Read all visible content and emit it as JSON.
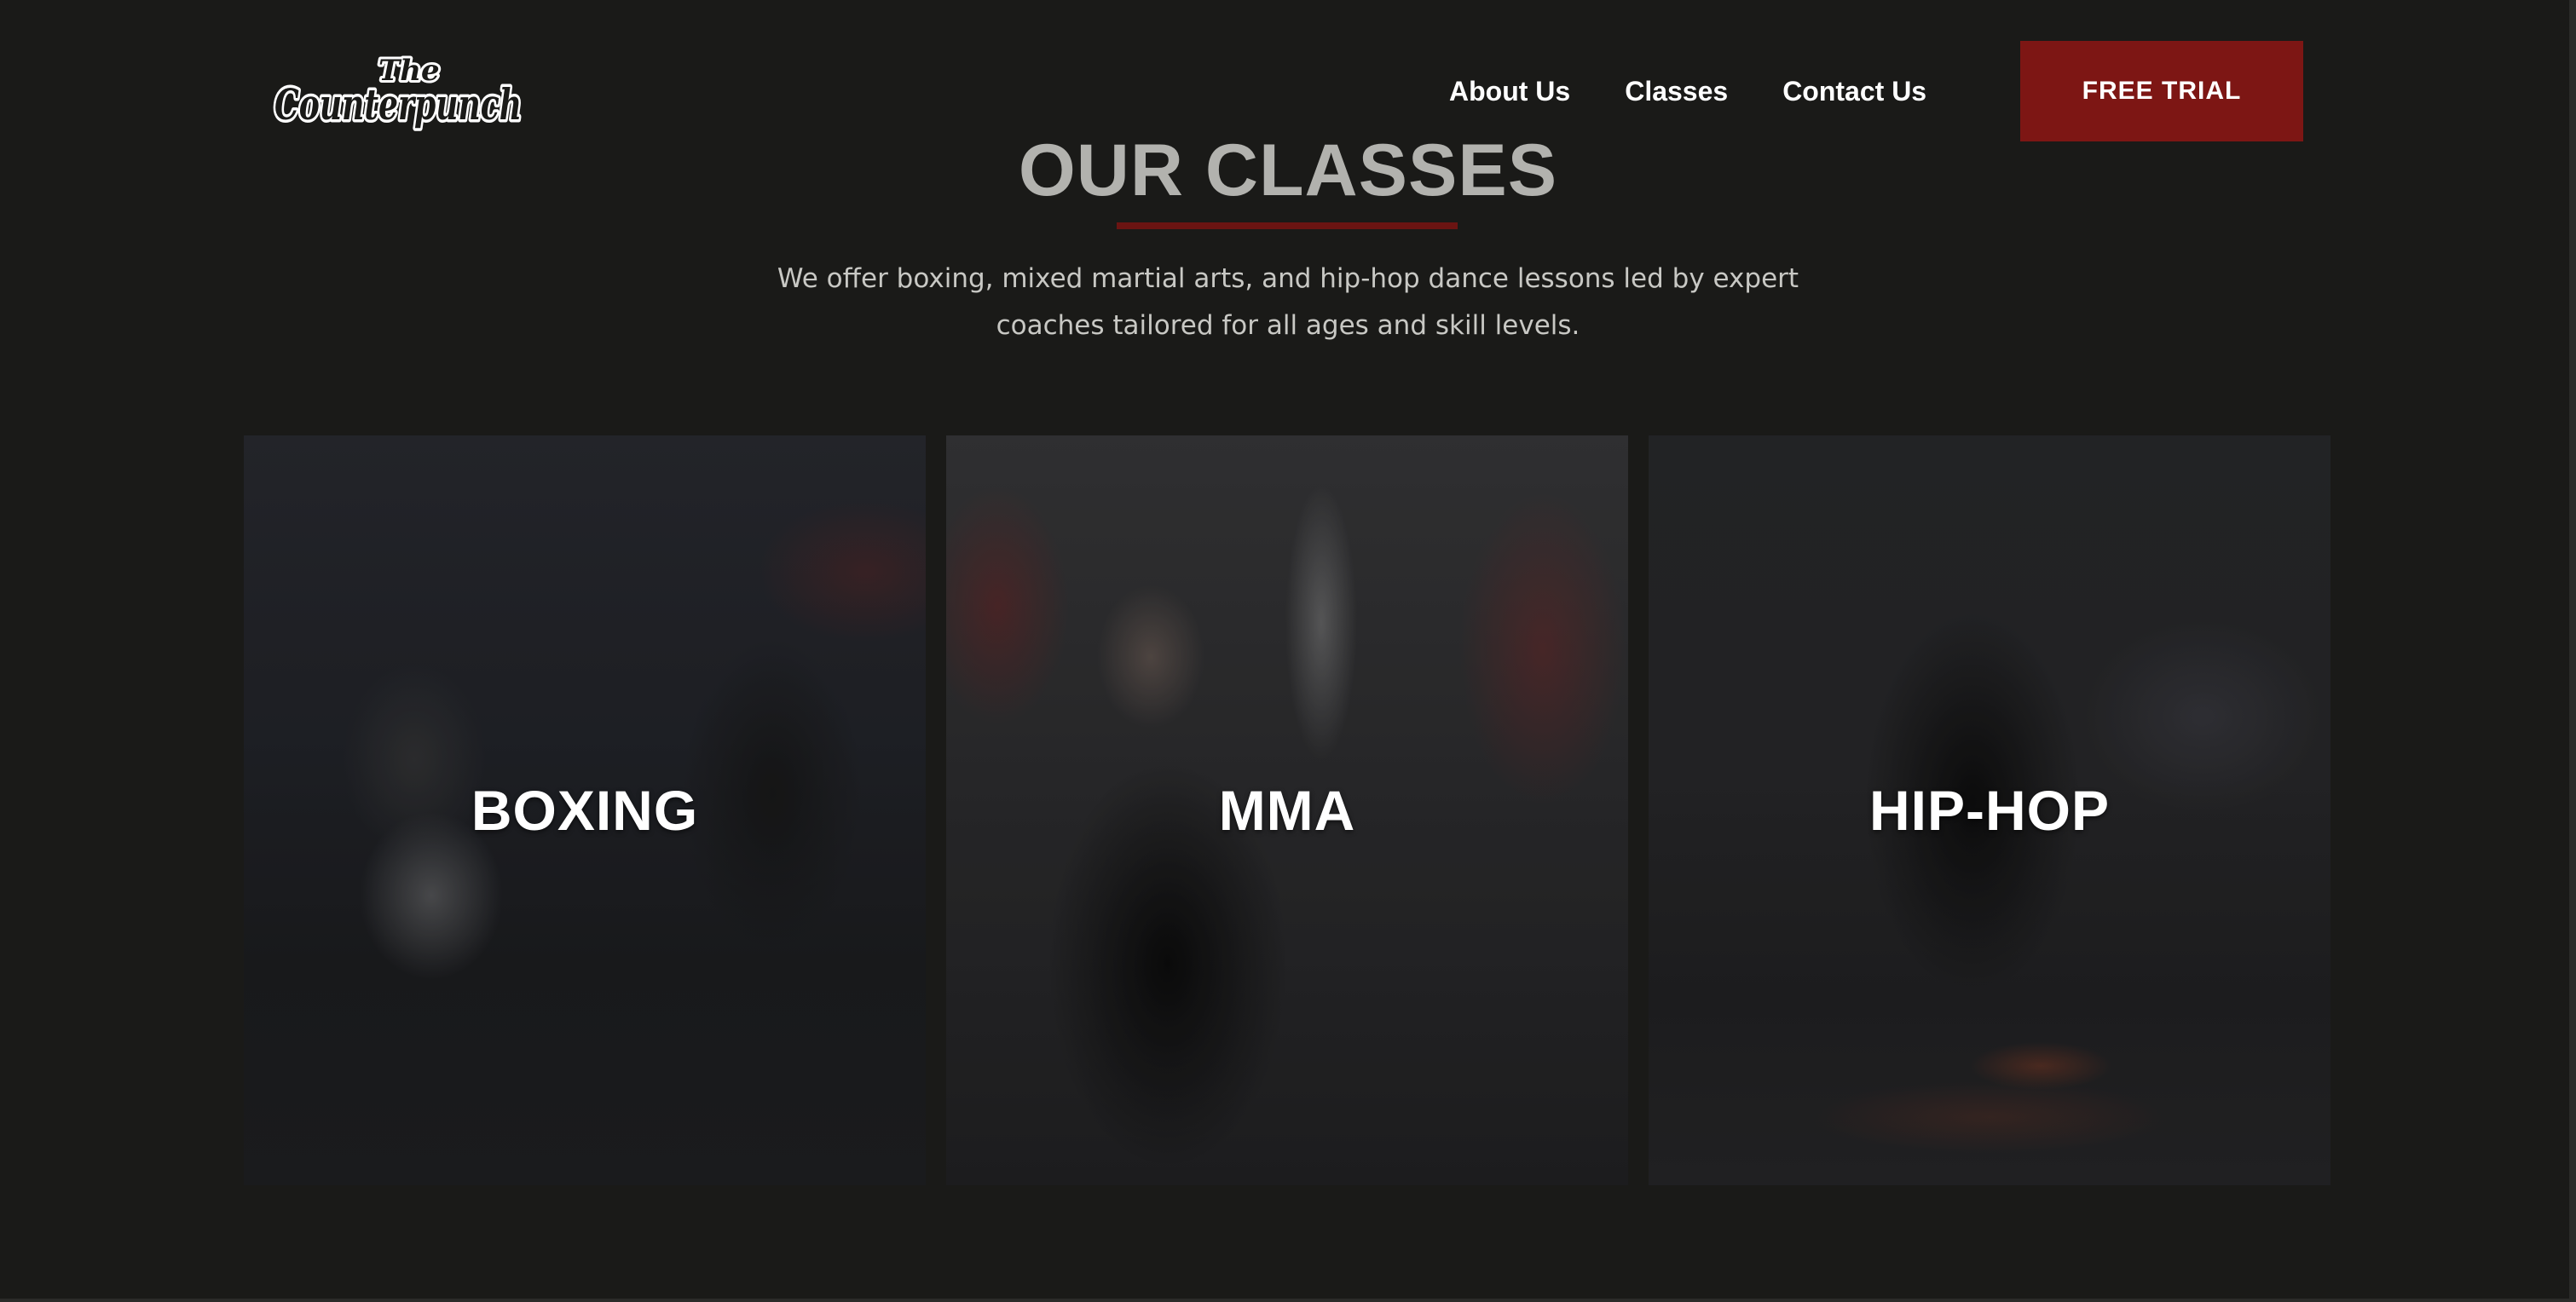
{
  "header": {
    "logo_text": "The Counterpunch",
    "nav": [
      {
        "label": "About Us"
      },
      {
        "label": "Classes"
      },
      {
        "label": "Contact Us"
      }
    ],
    "cta_label": "FREE TRIAL"
  },
  "section": {
    "title": "OUR CLASSES",
    "intro": "We offer boxing, mixed martial arts, and hip-hop dance lessons led by expert coaches tailored for all ages and skill levels.",
    "cards": [
      {
        "label": "BOXING"
      },
      {
        "label": "MMA"
      },
      {
        "label": "HIP-HOP"
      }
    ]
  },
  "colors": {
    "background": "#1a1a18",
    "accent": "#7d1614",
    "title": "#b2b2ae",
    "text": "#c8c8c4"
  }
}
